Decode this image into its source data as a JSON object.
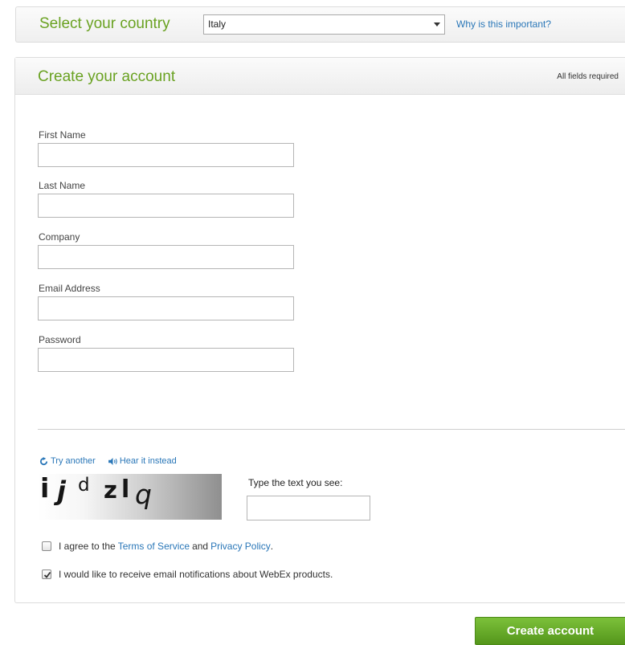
{
  "country": {
    "title": "Select your country",
    "selected": "Italy",
    "why_link": "Why is this important?"
  },
  "account": {
    "title": "Create your account",
    "all_required": "All fields required",
    "fields": {
      "first_name": "First Name",
      "last_name": "Last Name",
      "company": "Company",
      "email": "Email Address",
      "password": "Password"
    }
  },
  "captcha": {
    "try_another": "Try another",
    "hear_instead": "Hear it instead",
    "image_text": [
      "i",
      "j",
      "d",
      "z",
      "l",
      "q"
    ],
    "prompt": "Type the text you see:"
  },
  "agreements": {
    "terms": {
      "checked": false,
      "text_before": "I agree to the ",
      "terms_link": "Terms of Service",
      "text_middle": " and ",
      "privacy_link": "Privacy Policy",
      "text_after": "."
    },
    "notifications": {
      "checked": true,
      "text": "I would like to receive email notifications about WebEx products."
    }
  },
  "submit_label": "Create account",
  "colors": {
    "accent_green": "#6aa222",
    "link_blue": "#2a77b8",
    "button_green": "#63a827"
  },
  "icons": {
    "refresh": "refresh-icon",
    "audio": "speaker-icon",
    "dropdown": "chevron-down-icon",
    "check": "checkmark-icon"
  }
}
